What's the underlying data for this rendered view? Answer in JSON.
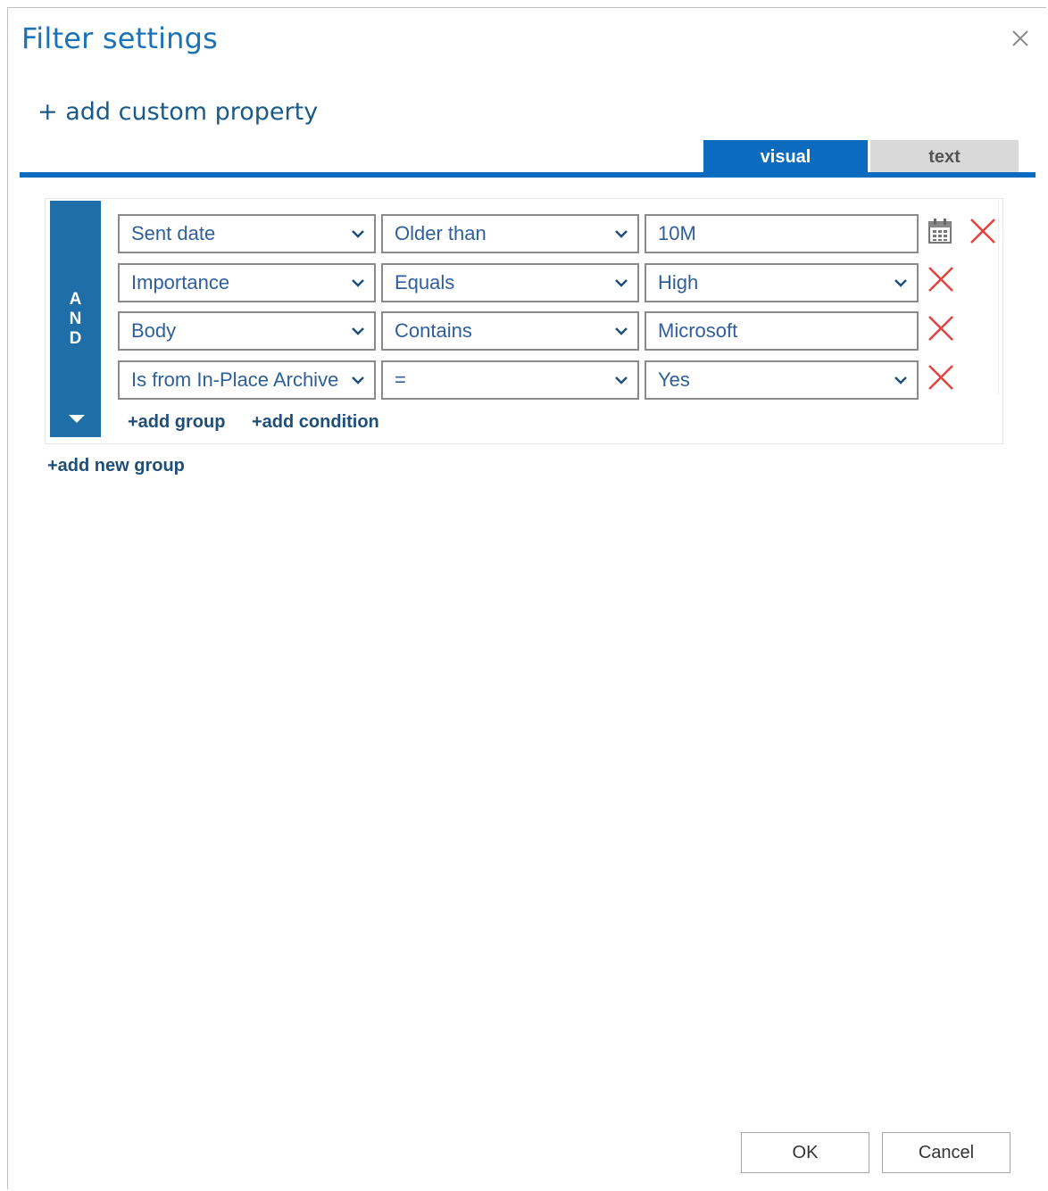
{
  "dialog": {
    "title": "Filter settings",
    "add_custom_property": "+ add custom property",
    "tabs": [
      {
        "label": "visual",
        "active": true
      },
      {
        "label": "text",
        "active": false
      }
    ]
  },
  "group": {
    "operator_letters": [
      "A",
      "N",
      "D"
    ],
    "conditions": [
      {
        "property": "Sent date",
        "operator": "Older than",
        "value": "10M",
        "value_kind": "input-with-calendar"
      },
      {
        "property": "Importance",
        "operator": "Equals",
        "value": "High",
        "value_kind": "select"
      },
      {
        "property": "Body",
        "operator": "Contains",
        "value": "Microsoft",
        "value_kind": "input"
      },
      {
        "property": "Is from In-Place Archive",
        "operator": "=",
        "value": "Yes",
        "value_kind": "select"
      }
    ],
    "add_group": "+add group",
    "add_condition": "+add condition"
  },
  "add_new_group": "+add new group",
  "buttons": {
    "ok": "OK",
    "cancel": "Cancel"
  },
  "colors": {
    "accent": "#0a6bbf",
    "and_bar": "#1f6ea8",
    "delete": "#e8403f",
    "link": "#1f4e79"
  },
  "icons": {
    "close": "close-icon",
    "chevron": "chevron-down-icon",
    "delete": "delete-x-icon",
    "calendar": "calendar-icon"
  }
}
